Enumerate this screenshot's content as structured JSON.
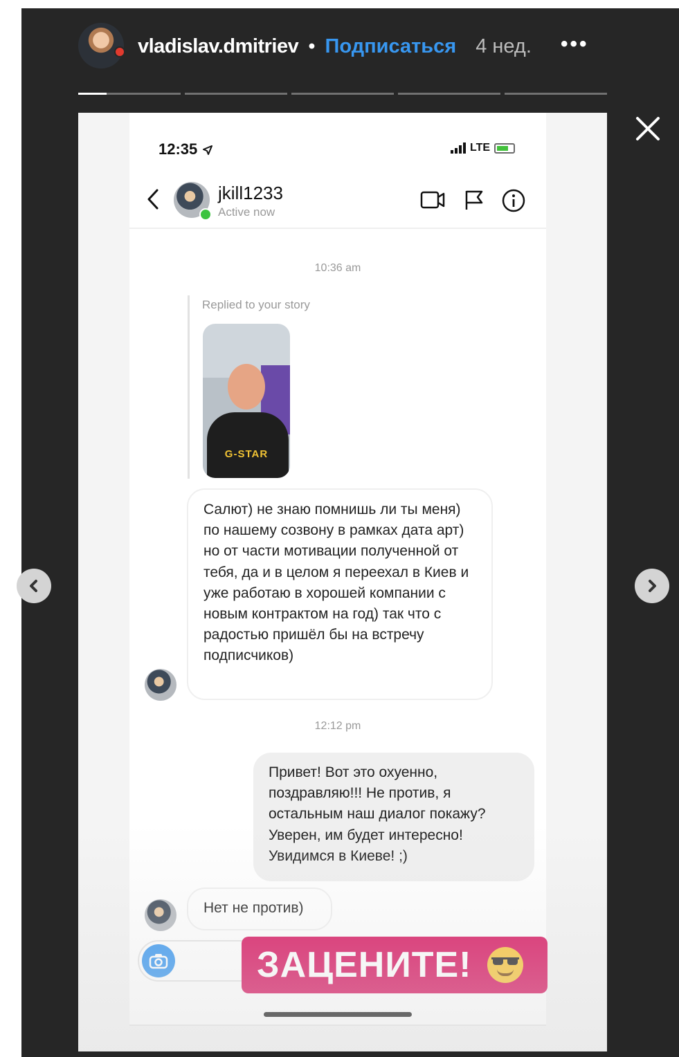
{
  "header": {
    "username": "vladislav.dmitriev",
    "separator": "•",
    "follow_label": "Подписаться",
    "time_ago": "4 нед.",
    "more_label": "•••"
  },
  "progress": {
    "segments": 5,
    "active_index": 0,
    "active_fraction": 0.28
  },
  "phone": {
    "status_time": "12:35",
    "network": "LTE",
    "chat": {
      "username": "jkill1233",
      "presence": "Active now"
    },
    "messages": {
      "timestamp_1": "10:36 am",
      "reply_label": "Replied to your story",
      "story_sticker_text": "G-STAR",
      "incoming_1": "Салют) не знаю помнишь ли ты меня) по нашему созвону в рамках дата арт) но от части мотивации полученной от тебя, да и в целом я переехал в Киев и уже работаю в хорошей компании с новым контрактом на год) так что с радостью пришёл бы на встречу подписчиков)",
      "timestamp_2": "12:12 pm",
      "outgoing_1": "Привет! Вот это охуенно, поздравляю!!! Не против, я остальным наш диалог покажу? Уверен, им будет интересно! Увидимся в Киеве! ;)",
      "incoming_2": "Нет не против)"
    },
    "sticker_text": "ЗАЦЕНИТЕ!"
  },
  "colors": {
    "follow": "#3897f0",
    "sticker": "#d7125e",
    "online": "#3cc340",
    "viewer_bg": "#262626"
  },
  "icons": [
    "close-icon",
    "chevron-left-icon",
    "chevron-right-icon",
    "video-call-icon",
    "flag-icon",
    "info-icon",
    "camera-icon",
    "plus-icon",
    "location-arrow-icon",
    "sunglasses-emoji-icon"
  ]
}
